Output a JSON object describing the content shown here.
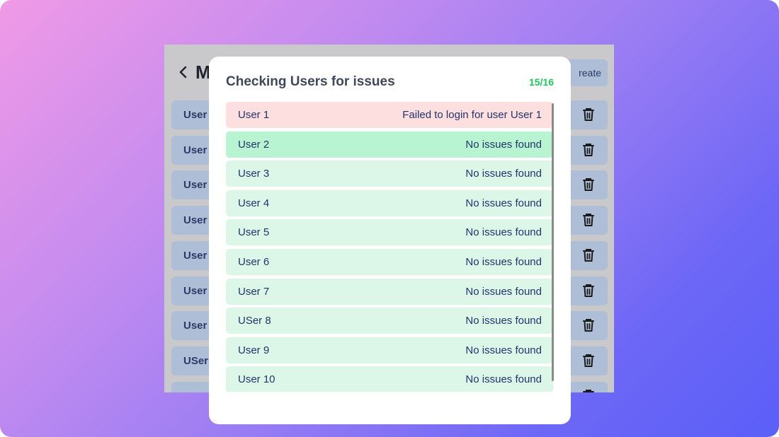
{
  "background_app": {
    "title": "M",
    "create_label": "reate",
    "rows": [
      {
        "label": "User"
      },
      {
        "label": "User"
      },
      {
        "label": "User"
      },
      {
        "label": "User"
      },
      {
        "label": "User"
      },
      {
        "label": "User"
      },
      {
        "label": "User"
      },
      {
        "label": "USer"
      },
      {
        "label": "U"
      }
    ]
  },
  "modal": {
    "title": "Checking Users for issues",
    "progress": "15/16",
    "results": [
      {
        "name": "User 1",
        "status": "Failed to login for user User 1",
        "state": "fail"
      },
      {
        "name": "User 2",
        "status": "No issues found",
        "state": "active"
      },
      {
        "name": "User 3",
        "status": "No issues found",
        "state": "ok"
      },
      {
        "name": "User 4",
        "status": "No issues found",
        "state": "ok"
      },
      {
        "name": "User 5",
        "status": "No issues found",
        "state": "ok"
      },
      {
        "name": "User 6",
        "status": "No issues found",
        "state": "ok"
      },
      {
        "name": "User 7",
        "status": "No issues found",
        "state": "ok"
      },
      {
        "name": "USer 8",
        "status": "No issues found",
        "state": "ok"
      },
      {
        "name": "User 9",
        "status": "No issues found",
        "state": "ok"
      },
      {
        "name": "User 10",
        "status": "No issues found",
        "state": "ok"
      }
    ]
  },
  "colors": {
    "success": "#22c55e",
    "fail_row": "#fedfdf",
    "ok_row": "#dcf6e8",
    "active_row": "#b8f3d2",
    "text": "#23346b"
  }
}
